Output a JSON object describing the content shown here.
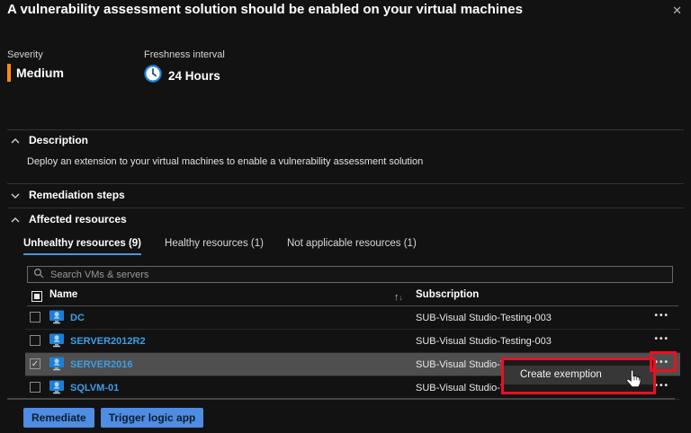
{
  "panel": {
    "title": "A vulnerability assessment solution should be enabled on your virtual machines"
  },
  "meta": {
    "severity_label": "Severity",
    "severity_value": "Medium",
    "freshness_label": "Freshness interval",
    "freshness_value": "24 Hours"
  },
  "sections": {
    "description": {
      "label": "Description",
      "state": "expanded",
      "body": "Deploy an extension to your virtual machines to enable a vulnerability assessment solution"
    },
    "remediation": {
      "label": "Remediation steps",
      "state": "collapsed"
    },
    "affected": {
      "label": "Affected resources",
      "state": "expanded"
    }
  },
  "tabs": [
    {
      "label": "Unhealthy resources (9)",
      "active": true
    },
    {
      "label": "Healthy resources (1)",
      "active": false
    },
    {
      "label": "Not applicable resources (1)",
      "active": false
    }
  ],
  "search": {
    "placeholder": "Search VMs & servers"
  },
  "table": {
    "select_all_state": "indeterminate",
    "columns": {
      "name": "Name",
      "subscription": "Subscription"
    },
    "rows": [
      {
        "name": "DC",
        "subscription": "SUB-Visual Studio-Testing-003",
        "checked": false,
        "selected": false
      },
      {
        "name": "SERVER2012R2",
        "subscription": "SUB-Visual Studio-Testing-003",
        "checked": false,
        "selected": false
      },
      {
        "name": "SERVER2016",
        "subscription": "SUB-Visual Studio-Testing-003",
        "checked": true,
        "selected": true
      },
      {
        "name": "SQLVM-01",
        "subscription": "SUB-Visual Studio-Testing-003",
        "checked": false,
        "selected": false
      }
    ]
  },
  "context_menu": {
    "item": "Create exemption"
  },
  "footer": {
    "remediate_label": "Remediate",
    "trigger_label": "Trigger logic app"
  },
  "icons": {
    "close": "✕",
    "sort_asc": "↑",
    "sort_desc": "↓",
    "ellipsis": "•••",
    "check": "✓"
  },
  "colors": {
    "severity_medium": "#ff8c00",
    "accent_blue": "#4e8de2",
    "link_blue": "#3aa0e8",
    "tab_underline": "#4894e0",
    "annotation_red": "#e81123",
    "selected_row": "#4f4f4f",
    "background": "#121212"
  }
}
